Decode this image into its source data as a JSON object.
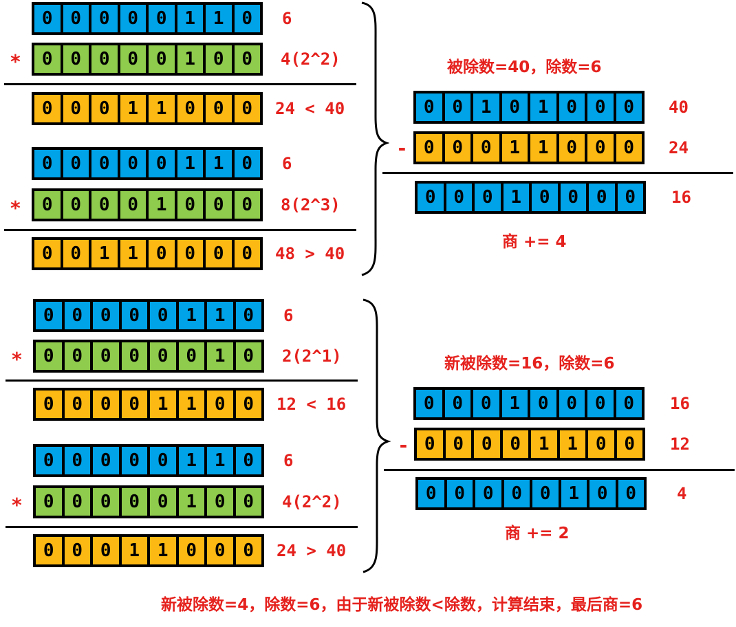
{
  "colors": {
    "blue": "#00a3e8",
    "green": "#8fcb4c",
    "gold": "#fdb913",
    "red": "#e5211d"
  },
  "operators": {
    "multiply": "*",
    "subtract": "-"
  },
  "left_blocks": [
    {
      "divisor": {
        "bits": "00000110",
        "label": "6"
      },
      "multiplier": {
        "bits": "00000100",
        "label": "4(2^2)"
      },
      "product": {
        "bits": "00011000",
        "label": "24 < 40"
      }
    },
    {
      "divisor": {
        "bits": "00000110",
        "label": "6"
      },
      "multiplier": {
        "bits": "00001000",
        "label": "8(2^3)"
      },
      "product": {
        "bits": "00110000",
        "label": "48 > 40"
      }
    },
    {
      "divisor": {
        "bits": "00000110",
        "label": "6"
      },
      "multiplier": {
        "bits": "00000010",
        "label": "2(2^1)"
      },
      "product": {
        "bits": "00001100",
        "label": "12 < 16"
      }
    },
    {
      "divisor": {
        "bits": "00000110",
        "label": "6"
      },
      "multiplier": {
        "bits": "00000100",
        "label": "4(2^2)"
      },
      "product": {
        "bits": "00011000",
        "label": "24 > 40"
      }
    }
  ],
  "right_blocks": [
    {
      "title": "被除数=40，除数=6",
      "dividend": {
        "bits": "00101000",
        "label": "40"
      },
      "subtrahend": {
        "bits": "00011000",
        "label": "24"
      },
      "result": {
        "bits": "00010000",
        "label": "16"
      },
      "quotient_step": "商 += 4"
    },
    {
      "title": "新被除数=16，除数=6",
      "dividend": {
        "bits": "00010000",
        "label": "16"
      },
      "subtrahend": {
        "bits": "00001100",
        "label": "12"
      },
      "result": {
        "bits": "00000100",
        "label": "4"
      },
      "quotient_step": "商 += 2"
    }
  ],
  "footer": "新被除数=4，除数=6，由于新被除数<除数，计算结束，最后商=6"
}
